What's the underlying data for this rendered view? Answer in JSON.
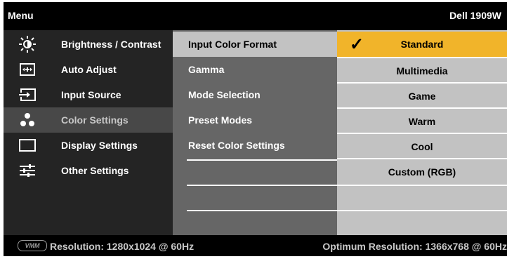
{
  "header": {
    "menu_label": "Menu",
    "model": "Dell 1909W"
  },
  "menu": {
    "items": [
      {
        "label": "Brightness / Contrast",
        "icon": "brightness-icon"
      },
      {
        "label": "Auto Adjust",
        "icon": "auto-adjust-icon"
      },
      {
        "label": "Input Source",
        "icon": "input-source-icon"
      },
      {
        "label": "Color Settings",
        "icon": "color-settings-icon",
        "selected": true
      },
      {
        "label": "Display Settings",
        "icon": "display-settings-icon"
      },
      {
        "label": "Other Settings",
        "icon": "other-settings-icon"
      }
    ]
  },
  "submenu": {
    "items": [
      {
        "label": "Input Color Format",
        "active": true
      },
      {
        "label": "Gamma"
      },
      {
        "label": "Mode Selection"
      },
      {
        "label": "Preset Modes"
      },
      {
        "label": "Reset Color Settings"
      }
    ]
  },
  "options": {
    "items": [
      {
        "label": "Standard",
        "selected": true
      },
      {
        "label": "Multimedia"
      },
      {
        "label": "Game"
      },
      {
        "label": "Warm"
      },
      {
        "label": "Cool"
      },
      {
        "label": "Custom (RGB)"
      }
    ]
  },
  "footer": {
    "logo": "VMM",
    "resolution": "Resolution: 1280x1024 @ 60Hz",
    "optimum": "Optimum Resolution: 1366x768 @ 60Hz"
  },
  "colors": {
    "selected_option": "#f1b42a",
    "active_submenu": "#c2c2c2",
    "selected_menu": "#484848"
  }
}
